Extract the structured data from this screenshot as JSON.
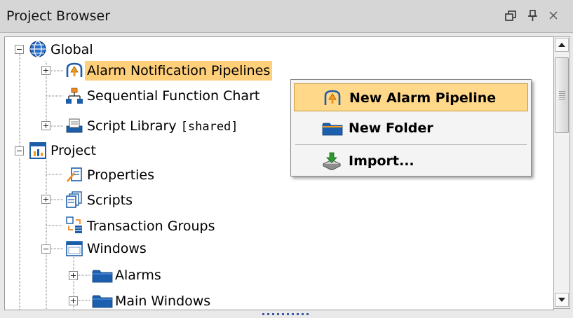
{
  "panel": {
    "title": "Project Browser",
    "controls": [
      "restore-icon",
      "pin-icon",
      "close-icon"
    ]
  },
  "tree": {
    "global": {
      "label": "Global",
      "icon": "globe-icon"
    },
    "alarm_pipelines": {
      "label": "Alarm Notification Pipelines",
      "icon": "alarm-pipeline-icon",
      "selected": true
    },
    "sfc": {
      "label": "Sequential Function Chart",
      "icon": "sfc-icon"
    },
    "script_library": {
      "label": "Script Library",
      "suffix": "[shared]",
      "icon": "script-library-icon"
    },
    "project": {
      "label": "Project",
      "icon": "project-icon"
    },
    "properties": {
      "label": "Properties",
      "icon": "properties-icon"
    },
    "scripts": {
      "label": "Scripts",
      "icon": "scripts-icon"
    },
    "transaction_groups": {
      "label": "Transaction Groups",
      "icon": "transaction-groups-icon"
    },
    "windows": {
      "label": "Windows",
      "icon": "windows-icon"
    },
    "alarms": {
      "label": "Alarms",
      "icon": "folder-icon"
    },
    "main_windows": {
      "label": "Main Windows",
      "icon": "folder-icon"
    }
  },
  "context_menu": {
    "items": [
      {
        "label": "New Alarm Pipeline",
        "icon": "alarm-pipeline-icon",
        "highlighted": true
      },
      {
        "label": "New Folder",
        "icon": "folder-icon"
      },
      {
        "label": "Import...",
        "icon": "import-icon"
      }
    ]
  },
  "colors": {
    "selection": "#ffcf7a",
    "menu_highlight": "#ffd88a",
    "folder_blue": "#1b5fae",
    "titlebar": "#d6d6d6"
  }
}
